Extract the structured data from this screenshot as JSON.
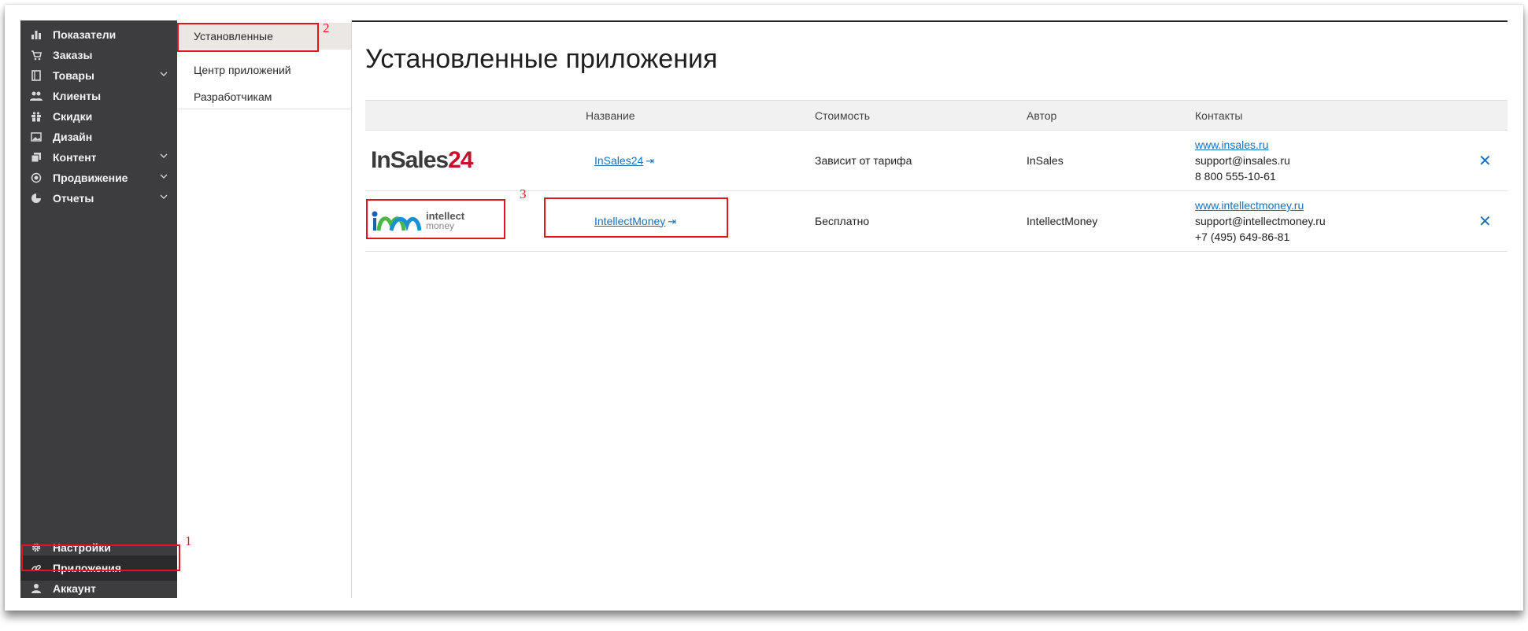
{
  "sidebar": {
    "items": [
      {
        "label": "Показатели",
        "icon": "chart-bar-icon",
        "has_submenu": false
      },
      {
        "label": "Заказы",
        "icon": "cart-icon",
        "has_submenu": false
      },
      {
        "label": "Товары",
        "icon": "book-icon",
        "has_submenu": true
      },
      {
        "label": "Клиенты",
        "icon": "users-icon",
        "has_submenu": false
      },
      {
        "label": "Скидки",
        "icon": "gift-icon",
        "has_submenu": false
      },
      {
        "label": "Дизайн",
        "icon": "image-icon",
        "has_submenu": false
      },
      {
        "label": "Контент",
        "icon": "pages-icon",
        "has_submenu": true
      },
      {
        "label": "Продвижение",
        "icon": "target-icon",
        "has_submenu": true
      },
      {
        "label": "Отчеты",
        "icon": "pie-chart-icon",
        "has_submenu": true
      }
    ],
    "bottom_items": [
      {
        "label": "Настройки",
        "icon": "gear-icon"
      },
      {
        "label": "Приложения",
        "icon": "link-icon",
        "active": true
      },
      {
        "label": "Аккаунт",
        "icon": "user-icon"
      }
    ]
  },
  "submenu": {
    "items": [
      {
        "label": "Установленные",
        "active": true
      },
      {
        "label": "Центр приложений"
      },
      {
        "label": "Разработчикам"
      }
    ]
  },
  "main": {
    "title": "Установленные приложения",
    "columns": [
      "Название",
      "Стоимость",
      "Автор",
      "Контакты"
    ],
    "apps": [
      {
        "logo": {
          "part1": "InSales",
          "part2": "24"
        },
        "name": "InSales24",
        "cost": "Зависит от тарифа",
        "author": "InSales",
        "site": "www.insales.ru",
        "email": "support@insales.ru",
        "phone": "8 800 555-10-61"
      },
      {
        "logo": {
          "line1": "intellect",
          "line2": "money"
        },
        "name": "IntellectMoney",
        "cost": "Бесплатно",
        "author": "IntellectMoney",
        "site": "www.intellectmoney.ru",
        "email": "support@intellectmoney.ru",
        "phone": "+7 (495) 649-86-81"
      }
    ],
    "remove_symbol": "✕"
  },
  "annotations": [
    "1",
    "2",
    "3"
  ],
  "colors": {
    "sidebar_bg": "#3d3d3f",
    "link": "#1a6fb7",
    "annotation": "#e0151d",
    "brand_red": "#c8102e"
  }
}
